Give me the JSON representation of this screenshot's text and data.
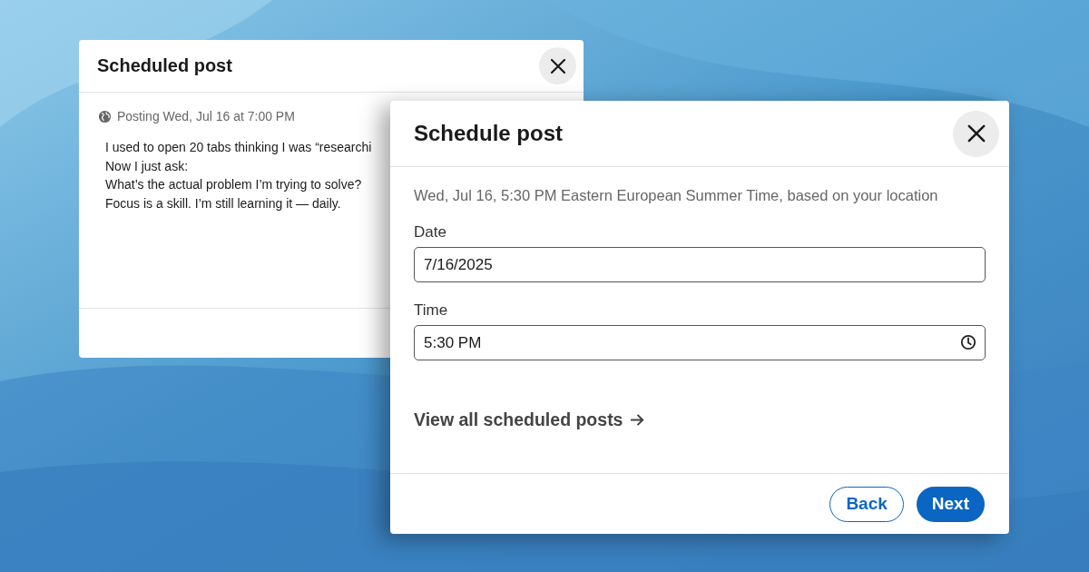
{
  "dialogs": [
    {
      "kind": "scheduled",
      "title": "Scheduled post",
      "posting": "Posting Wed, Jul 16 at 7:00 PM",
      "lines": [
        "I used to open 20 tabs thinking I was “researchi",
        "Now I just ask:",
        "What’s the actual problem I’m trying to solve?",
        "Focus is a skill. I’m still learning it — daily."
      ]
    },
    {
      "kind": "schedule",
      "title": "Schedule post",
      "info": "Wed, Jul 16, 5:30 PM Eastern European Summer Time, based on your location",
      "fields": [
        {
          "label": "Date",
          "value": "7/16/2025",
          "kind": "date"
        },
        {
          "label": "Time",
          "value": "5:30 PM",
          "kind": "time"
        }
      ],
      "link": "View all scheduled posts",
      "buttons": [
        {
          "label": "Back",
          "kind": "secondary"
        },
        {
          "label": "Next",
          "kind": "primary"
        }
      ]
    }
  ]
}
